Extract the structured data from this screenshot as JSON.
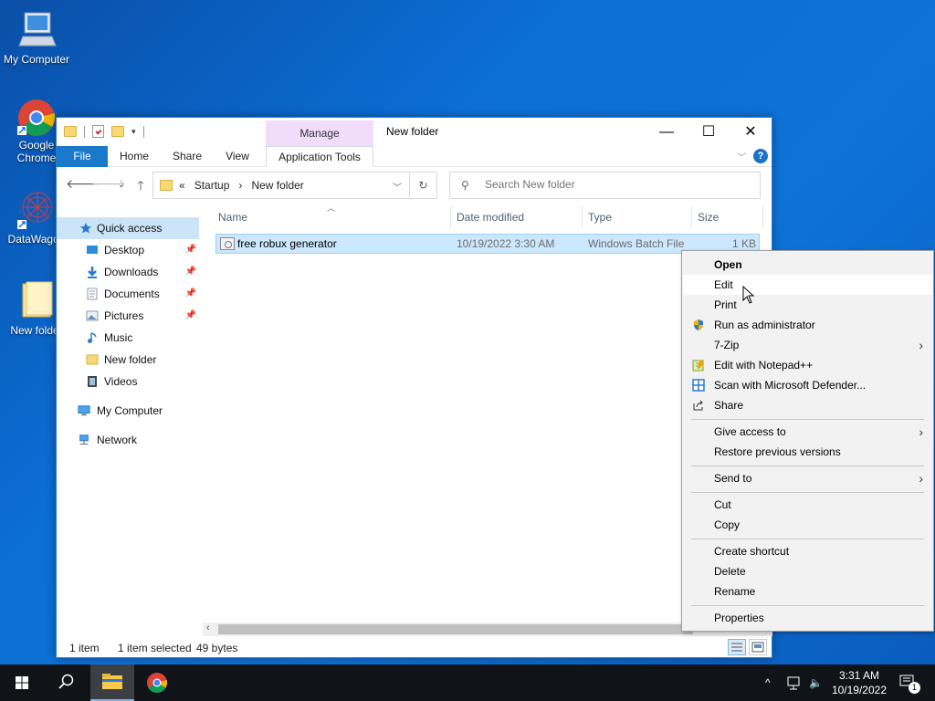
{
  "desktop": {
    "icons": [
      {
        "label": "My Computer",
        "icon": "monitor-icon"
      },
      {
        "label": "Google Chrome",
        "icon": "chrome-icon"
      },
      {
        "label": "DataWagon",
        "icon": "datawagon-icon"
      },
      {
        "label": "New folder",
        "icon": "folder-icon"
      }
    ]
  },
  "window": {
    "title": "New folder",
    "contextual_tab_group": "Manage",
    "ribbon_tabs": [
      "File",
      "Home",
      "Share",
      "View",
      "Application Tools"
    ],
    "controls": {
      "minimize": "—",
      "maximize": "☐",
      "close": "✕"
    },
    "help": "?",
    "address": {
      "prefix": "«",
      "parts": [
        "Startup",
        "New folder"
      ],
      "sep": "›"
    },
    "search_placeholder": "Search New folder",
    "nav": {
      "quick_access": "Quick access",
      "pinned": [
        "Desktop",
        "Downloads",
        "Documents",
        "Pictures"
      ],
      "unpinned": [
        "Music",
        "New folder",
        "Videos"
      ],
      "my_computer": "My Computer",
      "network": "Network"
    },
    "columns": [
      "Name",
      "Date modified",
      "Type",
      "Size"
    ],
    "files": [
      {
        "name": "free robux generator",
        "date": "10/19/2022 3:30 AM",
        "type": "Windows Batch File",
        "size": "1 KB",
        "selected": true
      }
    ],
    "status": {
      "count": "1 item",
      "selection": "1 item selected",
      "size": "49 bytes"
    }
  },
  "context_menu": {
    "groups": [
      [
        {
          "label": "Open",
          "bold": true
        },
        {
          "label": "Edit",
          "hover": true
        },
        {
          "label": "Print"
        },
        {
          "label": "Run as administrator",
          "icon": "shield-icon"
        },
        {
          "label": "7-Zip",
          "submenu": true
        },
        {
          "label": "Edit with Notepad++",
          "icon": "notepad-plus-plus-icon"
        },
        {
          "label": "Scan with Microsoft Defender...",
          "icon": "defender-icon"
        },
        {
          "label": "Share",
          "icon": "share-icon"
        }
      ],
      [
        {
          "label": "Give access to",
          "submenu": true
        },
        {
          "label": "Restore previous versions"
        }
      ],
      [
        {
          "label": "Send to",
          "submenu": true
        }
      ],
      [
        {
          "label": "Cut"
        },
        {
          "label": "Copy"
        }
      ],
      [
        {
          "label": "Create shortcut"
        },
        {
          "label": "Delete"
        },
        {
          "label": "Rename"
        }
      ],
      [
        {
          "label": "Properties"
        }
      ]
    ]
  },
  "taskbar": {
    "time": "3:31 AM",
    "date": "10/19/2022",
    "notification_count": "1"
  },
  "colors": {
    "accent": "#1979ca",
    "selection": "#cce8ff",
    "manage_tab": "#f1dcfb"
  }
}
